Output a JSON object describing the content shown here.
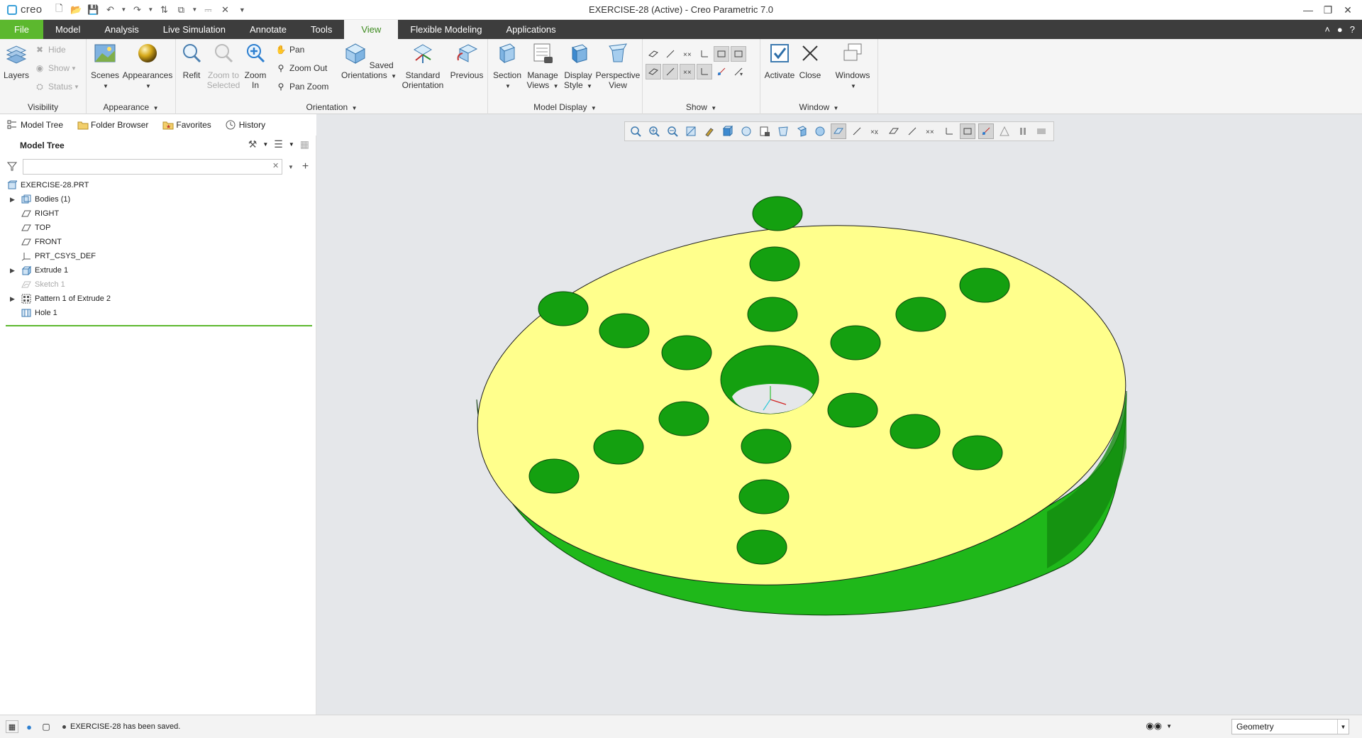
{
  "app": {
    "logo_text": "creo",
    "window_title": "EXERCISE-28 (Active) - Creo Parametric 7.0"
  },
  "ribbon_tabs": [
    "File",
    "Model",
    "Analysis",
    "Live Simulation",
    "Annotate",
    "Tools",
    "View",
    "Flexible Modeling",
    "Applications"
  ],
  "ribbon": {
    "visibility": {
      "label": "Visibility",
      "layers": "Layers",
      "hide": "Hide",
      "show": "Show",
      "status": "Status"
    },
    "appearance": {
      "label": "Appearance",
      "scenes": "Scenes",
      "appearances": "Appearances"
    },
    "orientation": {
      "label": "Orientation",
      "refit": "Refit",
      "zoom_to_selected_1": "Zoom to",
      "zoom_to_selected_2": "Selected",
      "zoom_in_1": "Zoom",
      "zoom_in_2": "In",
      "pan": "Pan",
      "zoom_out": "Zoom Out",
      "pan_zoom": "Pan Zoom",
      "saved_1": "Saved",
      "saved_2": "Orientations",
      "standard_1": "Standard",
      "standard_2": "Orientation",
      "previous": "Previous"
    },
    "model_display": {
      "label": "Model Display",
      "section": "Section",
      "manage_1": "Manage",
      "manage_2": "Views",
      "display_1": "Display",
      "display_2": "Style",
      "perspective_1": "Perspective",
      "perspective_2": "View"
    },
    "show": {
      "label": "Show"
    },
    "window": {
      "label": "Window",
      "activate": "Activate",
      "close": "Close",
      "windows": "Windows"
    }
  },
  "panel_tabs": {
    "model_tree": "Model Tree",
    "folder_browser": "Folder Browser",
    "favorites": "Favorites",
    "history": "History"
  },
  "model_tree": {
    "title": "Model Tree",
    "search_placeholder": "",
    "items": [
      {
        "label": "EXERCISE-28.PRT",
        "icon": "part-icon"
      },
      {
        "label": "Bodies (1)",
        "icon": "bodies-icon"
      },
      {
        "label": "RIGHT",
        "icon": "datum-plane-icon"
      },
      {
        "label": "TOP",
        "icon": "datum-plane-icon"
      },
      {
        "label": "FRONT",
        "icon": "datum-plane-icon"
      },
      {
        "label": "PRT_CSYS_DEF",
        "icon": "csys-icon"
      },
      {
        "label": "Extrude 1",
        "icon": "extrude-icon"
      },
      {
        "label": "Sketch 1",
        "icon": "sketch-icon"
      },
      {
        "label": "Pattern 1 of Extrude 2",
        "icon": "pattern-icon"
      },
      {
        "label": "Hole 1",
        "icon": "hole-icon"
      }
    ]
  },
  "status": {
    "message": "EXERCISE-28 has been saved.",
    "filter_value": "Geometry"
  },
  "colors": {
    "accent_green": "#5cb82e",
    "tab_bar": "#3d3d3d",
    "part_top": "#ffff8c",
    "part_side": "#1fb81a",
    "viewport_bg": "#e5e7ea"
  }
}
